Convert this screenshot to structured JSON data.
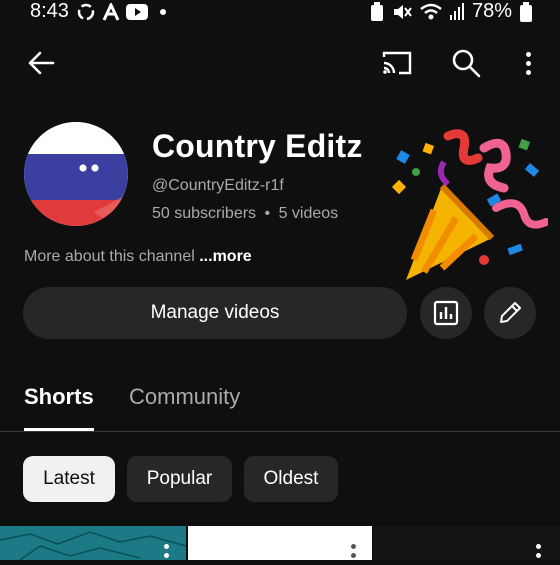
{
  "status_bar": {
    "time": "8:43",
    "battery": "78%"
  },
  "channel": {
    "name": "Country Editz",
    "handle": "@CountryEditz-r1f",
    "subscribers": "50 subscribers",
    "separator": "•",
    "videos": "5 videos",
    "about_text": "More about this channel",
    "more_label": "...more"
  },
  "actions": {
    "manage_videos_label": "Manage videos"
  },
  "tabs": [
    {
      "label": "Shorts",
      "active": true
    },
    {
      "label": "Community",
      "active": false
    }
  ],
  "filters": [
    {
      "label": "Latest",
      "selected": true
    },
    {
      "label": "Popular",
      "selected": false
    },
    {
      "label": "Oldest",
      "selected": false
    }
  ],
  "colors": {
    "background": "#0f0f0f",
    "surface": "#272727",
    "secondary_text": "#aaaaaa",
    "chip_selected": "#f1f1f1"
  },
  "icons": [
    "back-arrow-icon",
    "cast-icon",
    "search-icon",
    "more-vert-icon",
    "analytics-icon",
    "edit-pencil-icon",
    "party-popper-icon"
  ]
}
